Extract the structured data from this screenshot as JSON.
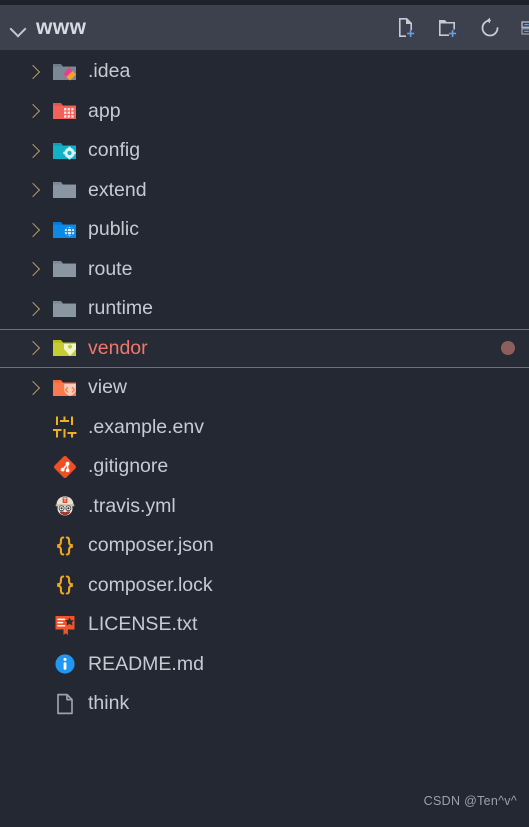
{
  "header": {
    "project_name": "www",
    "collapse_icon": "chevron-down-icon",
    "actions": [
      {
        "name": "new-file-button",
        "label": "New File",
        "icon": "new-file-icon"
      },
      {
        "name": "new-folder-button",
        "label": "New Folder",
        "icon": "new-folder-icon"
      },
      {
        "name": "refresh-button",
        "label": "Refresh",
        "icon": "refresh-icon"
      },
      {
        "name": "collapse-all-button",
        "label": "Collapse All",
        "icon": "collapse-all-icon"
      }
    ]
  },
  "tree": {
    "items": [
      {
        "label": ".idea",
        "type": "folder",
        "icon": "folder-idea-icon",
        "expanded": false,
        "selected": false,
        "marker": false
      },
      {
        "label": "app",
        "type": "folder",
        "icon": "folder-app-icon",
        "expanded": false,
        "selected": false,
        "marker": false
      },
      {
        "label": "config",
        "type": "folder",
        "icon": "folder-config-icon",
        "expanded": false,
        "selected": false,
        "marker": false
      },
      {
        "label": "extend",
        "type": "folder",
        "icon": "folder-plain-icon",
        "expanded": false,
        "selected": false,
        "marker": false
      },
      {
        "label": "public",
        "type": "folder",
        "icon": "folder-public-icon",
        "expanded": false,
        "selected": false,
        "marker": false
      },
      {
        "label": "route",
        "type": "folder",
        "icon": "folder-plain-icon",
        "expanded": false,
        "selected": false,
        "marker": false
      },
      {
        "label": "runtime",
        "type": "folder",
        "icon": "folder-plain-icon",
        "expanded": false,
        "selected": false,
        "marker": false
      },
      {
        "label": "vendor",
        "type": "folder",
        "icon": "folder-vendor-icon",
        "expanded": false,
        "selected": true,
        "marker": true
      },
      {
        "label": "view",
        "type": "folder",
        "icon": "folder-view-icon",
        "expanded": false,
        "selected": false,
        "marker": false
      },
      {
        "label": ".example.env",
        "type": "file",
        "icon": "tune-sliders-icon",
        "expanded": null,
        "selected": false,
        "marker": false
      },
      {
        "label": ".gitignore",
        "type": "file",
        "icon": "git-icon",
        "expanded": null,
        "selected": false,
        "marker": false
      },
      {
        "label": ".travis.yml",
        "type": "file",
        "icon": "travis-ci-icon",
        "expanded": null,
        "selected": false,
        "marker": false
      },
      {
        "label": "composer.json",
        "type": "file",
        "icon": "json-braces-icon",
        "expanded": null,
        "selected": false,
        "marker": false
      },
      {
        "label": "composer.lock",
        "type": "file",
        "icon": "json-braces-icon",
        "expanded": null,
        "selected": false,
        "marker": false
      },
      {
        "label": "LICENSE.txt",
        "type": "file",
        "icon": "license-award-icon",
        "expanded": null,
        "selected": false,
        "marker": false
      },
      {
        "label": "README.md",
        "type": "file",
        "icon": "info-circle-icon",
        "expanded": null,
        "selected": false,
        "marker": false
      },
      {
        "label": "think",
        "type": "file",
        "icon": "blank-document-icon",
        "expanded": null,
        "selected": false,
        "marker": false
      }
    ]
  },
  "watermark": {
    "text": "CSDN @Ten^v^"
  },
  "colors": {
    "background": "#242832",
    "toolbar": "#3c414d",
    "text": "#c6cad3",
    "selected_text": "#f2766b",
    "selection_border": "#4574d8",
    "arrow": "#b99a6b",
    "marker_dot": "#8c5f5d"
  }
}
